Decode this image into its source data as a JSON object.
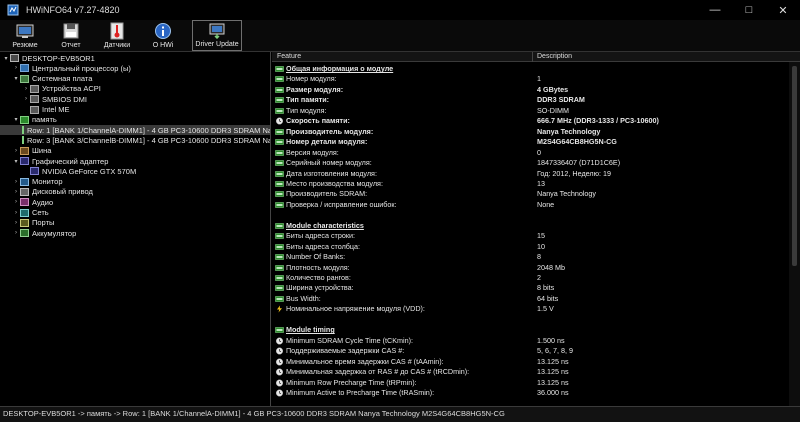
{
  "window": {
    "title": "HWiNFO64 v7.27-4820",
    "buttons": [
      "—",
      "□",
      "✕"
    ]
  },
  "toolbar": [
    {
      "label": "Резюме",
      "icon": "summary-icon"
    },
    {
      "label": "Отчет",
      "icon": "save-report-icon"
    },
    {
      "label": "Датчики",
      "icon": "sensors-thermometer-icon"
    },
    {
      "label": "О HWi",
      "icon": "info-icon"
    },
    {
      "label": "Driver Update",
      "icon": "driver-update-icon"
    }
  ],
  "tree": [
    {
      "label": "DESKTOP-EVB5OR1",
      "level": 0,
      "arrow": "▾",
      "icon": "pc"
    },
    {
      "label": "Центральный процессор (ы)",
      "level": 1,
      "arrow": "›",
      "icon": "cpu"
    },
    {
      "label": "Системная плата",
      "level": 1,
      "arrow": "▾",
      "icon": "board"
    },
    {
      "label": "Устройства ACPI",
      "level": 2,
      "arrow": "›",
      "icon": "chip"
    },
    {
      "label": "SMBIOS DMI",
      "level": 2,
      "arrow": "›",
      "icon": "chip"
    },
    {
      "label": "Intel ME",
      "level": 2,
      "arrow": "",
      "icon": "chip"
    },
    {
      "label": "память",
      "level": 1,
      "arrow": "▾",
      "icon": "mem"
    },
    {
      "label": "Row: 1 [BANK 1/ChannelA-DIMM1] - 4 GB PC3-10600 DDR3 SDRAM Nan",
      "level": 2,
      "arrow": "",
      "icon": "mem",
      "selected": true
    },
    {
      "label": "Row: 3 [BANK 3/ChannelB-DIMM1] - 4 GB PC3-10600 DDR3 SDRAM Nan",
      "level": 2,
      "arrow": "",
      "icon": "mem"
    },
    {
      "label": "Шина",
      "level": 1,
      "arrow": "›",
      "icon": "bus"
    },
    {
      "label": "Графический адаптер",
      "level": 1,
      "arrow": "▾",
      "icon": "gpu"
    },
    {
      "label": "NVIDIA GeForce GTX 570M",
      "level": 2,
      "arrow": "",
      "icon": "gpu"
    },
    {
      "label": "Монитор",
      "level": 1,
      "arrow": "›",
      "icon": "mon"
    },
    {
      "label": "Дисковый привод",
      "level": 1,
      "arrow": "›",
      "icon": "disk"
    },
    {
      "label": "Аудио",
      "level": 1,
      "arrow": "›",
      "icon": "audio"
    },
    {
      "label": "Сеть",
      "level": 1,
      "arrow": "›",
      "icon": "net"
    },
    {
      "label": "Порты",
      "level": 1,
      "arrow": "›",
      "icon": "port"
    },
    {
      "label": "Аккумулятор",
      "level": 1,
      "arrow": "›",
      "icon": "bat"
    }
  ],
  "details": {
    "columns": {
      "feature": "Feature",
      "description": "Description"
    },
    "rows": [
      {
        "feature": "Общая информация о модуле",
        "value": "",
        "type": "section"
      },
      {
        "feature": "Номер модуля:",
        "value": "1",
        "type": "normal"
      },
      {
        "feature": "Размер модуля:",
        "value": "4 GBytes",
        "type": "bold"
      },
      {
        "feature": "Тип памяти:",
        "value": "DDR3 SDRAM",
        "type": "bold"
      },
      {
        "feature": "Тип модуля:",
        "value": "SO-DIMM",
        "type": "normal"
      },
      {
        "feature": "Скорость памяти:",
        "value": "666.7 MHz (DDR3-1333 / PC3-10600)",
        "type": "bold",
        "icon": "clock"
      },
      {
        "feature": "Производитель модуля:",
        "value": "Nanya Technology",
        "type": "bold"
      },
      {
        "feature": "Номер детали модуля:",
        "value": "M2S4G64CB8HG5N-CG",
        "type": "bold"
      },
      {
        "feature": "Версия модуля:",
        "value": "0",
        "type": "normal"
      },
      {
        "feature": "Серийный номер модуля:",
        "value": "1847336407 (D71D1C6E)",
        "type": "normal"
      },
      {
        "feature": "Дата изготовления модуля:",
        "value": "Год: 2012, Неделю: 19",
        "type": "normal"
      },
      {
        "feature": "Место производства модуля:",
        "value": "13",
        "type": "normal"
      },
      {
        "feature": "Производитель SDRAM:",
        "value": "Nanya Technology",
        "type": "normal"
      },
      {
        "feature": "Проверка / исправление ошибок:",
        "value": "None",
        "type": "normal"
      },
      {
        "feature": "",
        "value": "",
        "type": "blank"
      },
      {
        "feature": "Module characteristics",
        "value": "",
        "type": "section"
      },
      {
        "feature": "Биты адреса строки:",
        "value": "15",
        "type": "normal"
      },
      {
        "feature": "Биты адреса столбца:",
        "value": "10",
        "type": "normal"
      },
      {
        "feature": "Number Of Banks:",
        "value": "8",
        "type": "normal"
      },
      {
        "feature": "Плотность модуля:",
        "value": "2048 Mb",
        "type": "normal"
      },
      {
        "feature": "Количество рангов:",
        "value": "2",
        "type": "normal"
      },
      {
        "feature": "Ширина устройства:",
        "value": "8 bits",
        "type": "normal"
      },
      {
        "feature": "Bus Width:",
        "value": "64 bits",
        "type": "normal"
      },
      {
        "feature": "Номинальное напряжение модуля (VDD):",
        "value": "1.5 V",
        "type": "normal",
        "icon": "bolt"
      },
      {
        "feature": "",
        "value": "",
        "type": "blank"
      },
      {
        "feature": "Module timing",
        "value": "",
        "type": "section"
      },
      {
        "feature": "Minimum SDRAM Cycle Time (tCKmin):",
        "value": "1.500 ns",
        "type": "normal",
        "icon": "clock"
      },
      {
        "feature": "Поддерживаемые задержки CAS #:",
        "value": "5, 6, 7, 8, 9",
        "type": "normal",
        "icon": "clock"
      },
      {
        "feature": "Минимальное время задержки CAS # (tAAmin):",
        "value": "13.125 ns",
        "type": "normal",
        "icon": "clock"
      },
      {
        "feature": "Минимальная задержка от RAS # до CAS # (tRCDmin):",
        "value": "13.125 ns",
        "type": "normal",
        "icon": "clock"
      },
      {
        "feature": "Minimum Row Precharge Time (tRPmin):",
        "value": "13.125 ns",
        "type": "normal",
        "icon": "clock"
      },
      {
        "feature": "Minimum Active to Precharge Time (tRASmin):",
        "value": "36.000 ns",
        "type": "normal",
        "icon": "clock"
      }
    ]
  },
  "status": "DESKTOP-EVB5OR1 -> память -> Row: 1 [BANK 1/ChannelA-DIMM1] - 4 GB PC3-10600 DDR3 SDRAM Nanya Technology M2S4G64CB8HG5N-CG"
}
